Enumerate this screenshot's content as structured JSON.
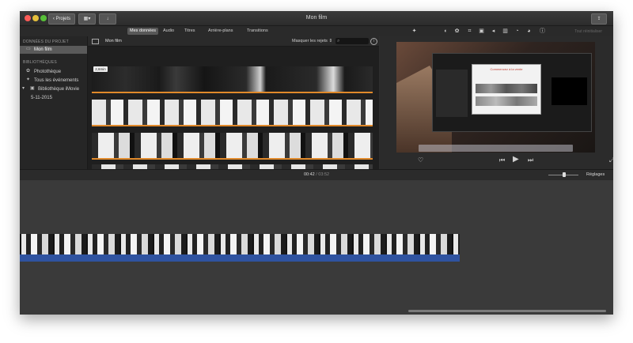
{
  "window": {
    "title": "Mon film"
  },
  "titlebar": {
    "projects_label": "Projets",
    "media_icon": "film-grid-icon",
    "import_icon": "arrow-down-icon",
    "share_icon": "share-icon"
  },
  "toolbar": {
    "tabs": [
      {
        "label": "Mes données",
        "active": true
      },
      {
        "label": "Audio",
        "active": false
      },
      {
        "label": "Titres",
        "active": false
      },
      {
        "label": "Arrière-plans",
        "active": false
      },
      {
        "label": "Transitions",
        "active": false
      }
    ],
    "reset_label": "Tout réinitialiser"
  },
  "sidebar": {
    "project_header": "DONNÉES DU PROJET",
    "project_item": "Mon film",
    "libraries_header": "BIBLIOTHÈQUES",
    "items": [
      {
        "label": "Photothèque",
        "icon": "photos-icon"
      },
      {
        "label": "Tous les événements",
        "icon": "star-icon"
      },
      {
        "label": "Bibliothèque iMovie",
        "icon": "library-icon"
      },
      {
        "label": "5-11-2015",
        "icon": ""
      }
    ]
  },
  "browser": {
    "title": "Mon film",
    "filter_label": "Masquer les rejets",
    "clip_duration": "2,6min"
  },
  "viewer": {
    "dialog_title": "Commencez à la vente"
  },
  "timeline": {
    "current_time": "00:42",
    "separator": "/",
    "total_time": "03:52",
    "settings_label": "Réglages"
  },
  "colors": {
    "accent_orange": "#e0892a",
    "audio_blue": "#2f53a0",
    "selection": "#5a5a5a"
  }
}
